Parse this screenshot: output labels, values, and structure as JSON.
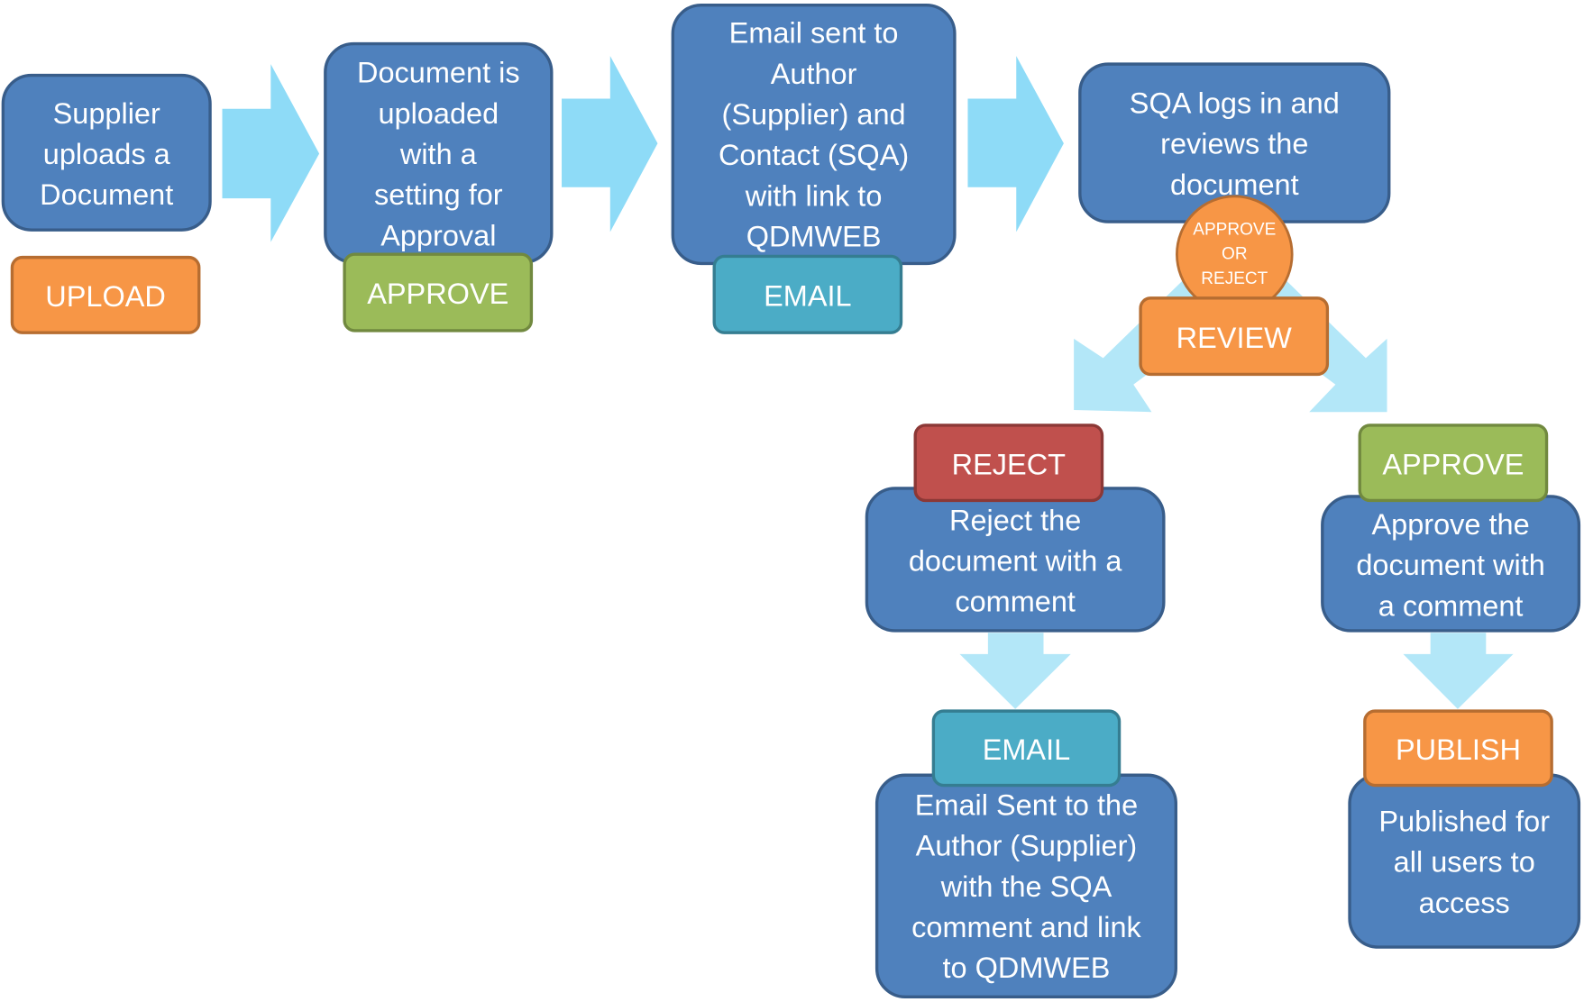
{
  "colors": {
    "process_fill": "#4F81BD",
    "process_stroke": "#385D8A",
    "orange": "#F79646",
    "orange_stroke": "#B66D31",
    "green": "#9BBB59",
    "green_stroke": "#71893F",
    "teal": "#4BACC6",
    "teal_stroke": "#357D91",
    "red": "#C0504D",
    "red_stroke": "#8C3836",
    "arrow_main": "#8EDBF7",
    "arrow_light": "#B3E7F8"
  },
  "steps": [
    {
      "id": "upload",
      "lines": [
        "Supplier",
        "uploads a",
        "Document"
      ],
      "tag": "UPLOAD",
      "tag_color": "orange"
    },
    {
      "id": "approval-setting",
      "lines": [
        "Document is",
        "uploaded",
        "with a",
        "setting for",
        "Approval"
      ],
      "tag": "APPROVE",
      "tag_color": "green"
    },
    {
      "id": "email-notify",
      "lines": [
        "Email sent to",
        "Author",
        "(Supplier) and",
        "Contact (SQA)",
        "with link to",
        "QDMWEB"
      ],
      "tag": "EMAIL",
      "tag_color": "teal"
    },
    {
      "id": "review",
      "lines": [
        "SQA logs in and",
        "reviews the",
        "document"
      ],
      "tag": "REVIEW",
      "tag_color": "orange"
    },
    {
      "id": "reject",
      "lines": [
        "Reject the",
        "document with a",
        "comment"
      ],
      "tag": "REJECT",
      "tag_color": "red"
    },
    {
      "id": "reject-email",
      "lines": [
        "Email Sent to the",
        "Author (Supplier)",
        "with the SQA",
        "comment and link",
        "to QDMWEB"
      ],
      "tag": "EMAIL",
      "tag_color": "teal"
    },
    {
      "id": "approve",
      "lines": [
        "Approve the",
        "document with",
        "a comment"
      ],
      "tag": "APPROVE",
      "tag_color": "green"
    },
    {
      "id": "publish",
      "lines": [
        "Published for",
        "all users to",
        "access"
      ],
      "tag": "PUBLISH",
      "tag_color": "orange"
    }
  ],
  "decision": {
    "lines": [
      "APPROVE",
      "OR",
      "REJECT"
    ]
  }
}
